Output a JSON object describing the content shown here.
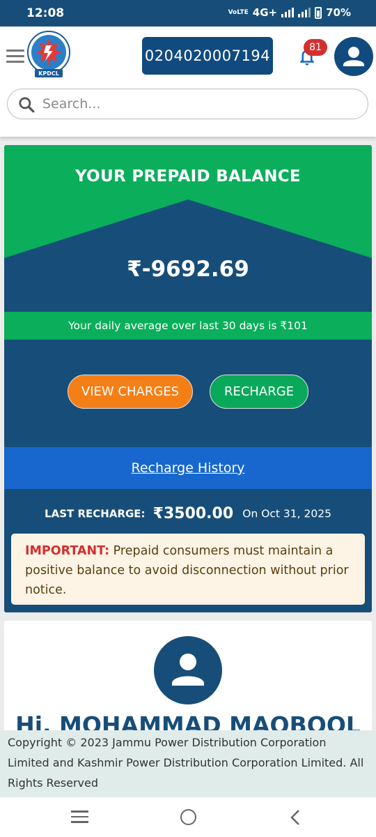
{
  "status_bar": {
    "time": "12:08",
    "network_top": "VoLTE",
    "network": "4G+",
    "battery": "70%"
  },
  "header": {
    "logo_text": "KPDCL",
    "account_number": "0204020007194",
    "notification_count": "81",
    "search_placeholder": "Search..."
  },
  "balance_card": {
    "title": "YOUR PREPAID BALANCE",
    "balance": "₹-9692.69",
    "daily_average": "Your daily average over last 30 days is ₹101",
    "view_charges_label": "VIEW CHARGES",
    "recharge_label": "RECHARGE",
    "recharge_history_label": "Recharge History",
    "last_recharge_label": "LAST RECHARGE:",
    "last_recharge_amount": "₹3500.00",
    "last_recharge_date": "On Oct 31, 2025",
    "notice_label": "IMPORTANT:",
    "notice_text": "Prepaid consumers must maintain a positive balance to avoid disconnection without prior notice."
  },
  "profile": {
    "greeting": "Hi, MOHAMMAD MAQBOOL"
  },
  "footer": {
    "copyright": "Copyright © 2023 Jammu Power Distribution Corporation Limited and Kashmir Power Distribution Corporation Limited. All Rights Reserved"
  },
  "colors": {
    "primary": "#174e79",
    "green": "#0aae5b",
    "orange": "#f57f17",
    "blue": "#1767ce",
    "badge_red": "#d32f2f"
  }
}
